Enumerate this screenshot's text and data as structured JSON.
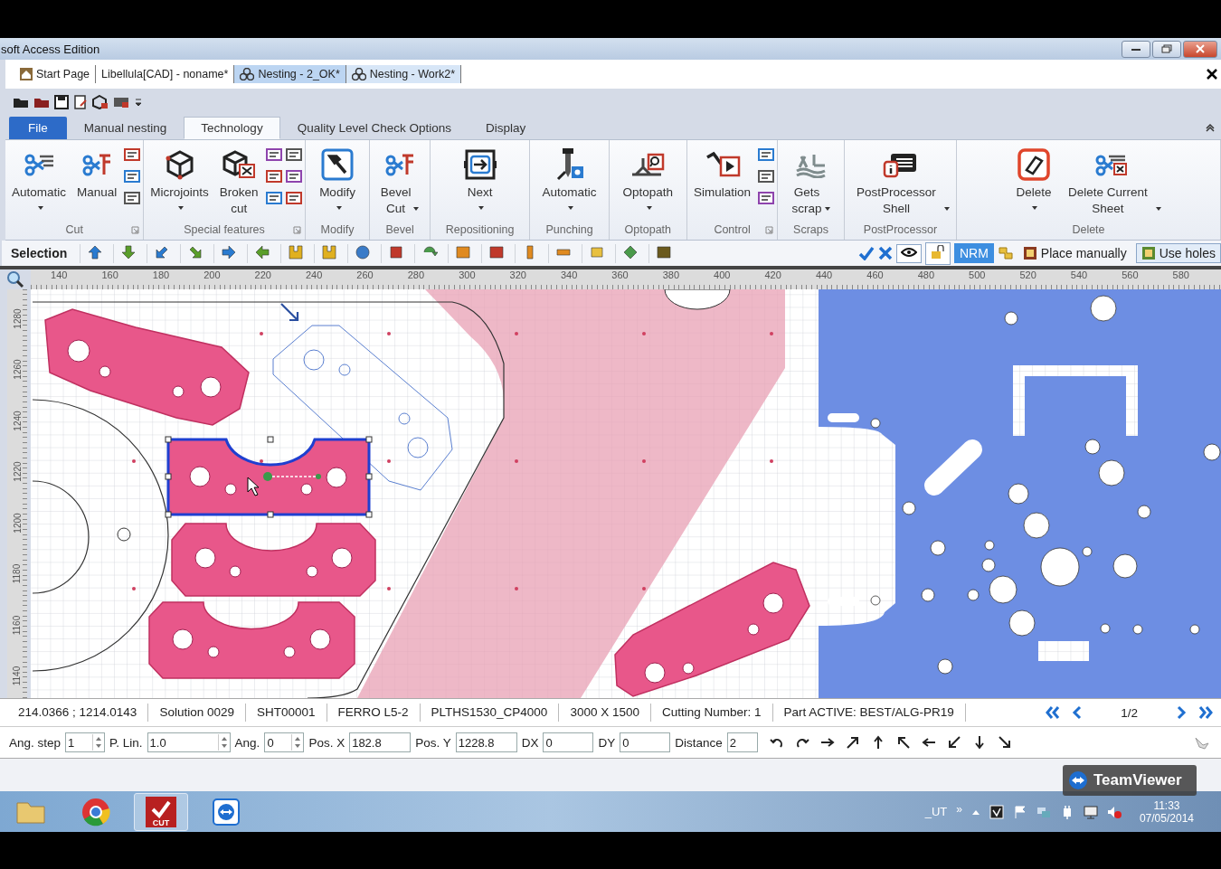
{
  "window": {
    "title": "soft Access Edition"
  },
  "doc_tabs": [
    {
      "label": "Start Page",
      "kind": "home",
      "selected": false
    },
    {
      "label": "Libellula[CAD] - noname*",
      "kind": "plain",
      "selected": false
    },
    {
      "label": "Nesting - 2_OK*",
      "kind": "nesting",
      "selected": true
    },
    {
      "label": "Nesting - Work2*",
      "kind": "nesting",
      "selected": false
    }
  ],
  "ribbon_tabs": [
    {
      "label": "File",
      "kind": "file",
      "selected": false
    },
    {
      "label": "Manual nesting",
      "kind": "tab",
      "selected": false
    },
    {
      "label": "Technology",
      "kind": "tab",
      "selected": true
    },
    {
      "label": "Quality Level Check Options",
      "kind": "tab",
      "selected": false
    },
    {
      "label": "Display",
      "kind": "tab",
      "selected": false
    }
  ],
  "ribbon_groups": [
    {
      "label": "Cut",
      "launcher": true,
      "items": [
        {
          "kind": "large",
          "label": "Automatic",
          "dropdown": true
        },
        {
          "kind": "large",
          "label": "Manual",
          "dropdown": false
        },
        {
          "kind": "small"
        }
      ]
    },
    {
      "label": "Special features",
      "launcher": true,
      "items": [
        {
          "kind": "large",
          "label": "Microjoints",
          "dropdown": true
        },
        {
          "kind": "large",
          "label": "Broken cut",
          "dropdown": false
        },
        {
          "kind": "small"
        },
        {
          "kind": "small"
        }
      ]
    },
    {
      "label": "Modify",
      "launcher": false,
      "items": [
        {
          "kind": "large",
          "label": "Modify",
          "dropdown": true
        }
      ]
    },
    {
      "label": "Bevel",
      "launcher": false,
      "items": [
        {
          "kind": "large",
          "label": "Bevel Cut",
          "dropdown": true
        }
      ]
    },
    {
      "label": "Repositioning",
      "launcher": false,
      "items": [
        {
          "kind": "large",
          "label": "Next",
          "dropdown": true
        }
      ]
    },
    {
      "label": "Punching",
      "launcher": false,
      "items": [
        {
          "kind": "large",
          "label": "Automatic",
          "dropdown": true
        }
      ]
    },
    {
      "label": "Optopath",
      "launcher": false,
      "items": [
        {
          "kind": "large",
          "label": "Optopath",
          "dropdown": true
        }
      ]
    },
    {
      "label": "Control",
      "launcher": true,
      "items": [
        {
          "kind": "large",
          "label": "Simulation",
          "dropdown": false
        },
        {
          "kind": "small"
        }
      ]
    },
    {
      "label": "Scraps",
      "launcher": false,
      "items": [
        {
          "kind": "large",
          "label": "Gets scrap",
          "dropdown": true
        }
      ]
    },
    {
      "label": "PostProcessor",
      "launcher": false,
      "items": [
        {
          "kind": "large",
          "label": "PostProcessor Shell",
          "dropdown": true
        }
      ]
    },
    {
      "label": "Delete",
      "launcher": false,
      "items": [
        {
          "kind": "large",
          "label": "Delete",
          "dropdown": true
        },
        {
          "kind": "large",
          "label": "Delete Current Sheet",
          "dropdown": true
        }
      ]
    }
  ],
  "selection_toolbar": {
    "label": "Selection",
    "right_tools": [
      {
        "kind": "text",
        "label": "NRM",
        "selected": true
      },
      {
        "kind": "labeled",
        "label": "Place manually",
        "selected": false
      },
      {
        "kind": "labeled",
        "label": "Use holes",
        "selected": true
      }
    ]
  },
  "ruler": {
    "horizontal": [
      "140",
      "160",
      "180",
      "200",
      "220",
      "240",
      "260",
      "280",
      "300",
      "320",
      "340",
      "360",
      "380",
      "400",
      "420",
      "440",
      "460",
      "480",
      "500",
      "520",
      "540",
      "560",
      "580"
    ],
    "vertical": [
      "1280",
      "1260",
      "1240",
      "1220",
      "1200",
      "1180",
      "1160",
      "1140"
    ]
  },
  "status_bar": {
    "cells": [
      "214.0366 ; 1214.0143",
      "Solution 0029",
      "SHT00001",
      "FERRO L5-2",
      "PLTHS1530_CP4000",
      "3000 X 1500",
      "Cutting Number: 1",
      "Part ACTIVE: BEST/ALG-PR19"
    ],
    "page": "1/2"
  },
  "input_bar": {
    "fields": [
      {
        "label": "Ang. step",
        "value": "1",
        "kind": "spin"
      },
      {
        "label": "P. Lin.",
        "value": "1.0",
        "kind": "spin"
      },
      {
        "label": "Ang.",
        "value": "0",
        "kind": "spin"
      },
      {
        "label": "Pos. X",
        "value": "182.8",
        "kind": "text"
      },
      {
        "label": "Pos. Y",
        "value": "1228.8",
        "kind": "text"
      },
      {
        "label": "DX",
        "value": "0",
        "kind": "text"
      },
      {
        "label": "DY",
        "value": "0",
        "kind": "text"
      },
      {
        "label": "Distance",
        "value": "2",
        "kind": "text"
      }
    ]
  },
  "teamviewer": {
    "label": "TeamViewer"
  },
  "taskbar": {
    "apps": [
      {
        "kind": "folder",
        "selected": false
      },
      {
        "kind": "browser",
        "selected": false
      },
      {
        "kind": "cut",
        "label": "CUT",
        "selected": true
      },
      {
        "kind": "remote",
        "selected": false
      }
    ],
    "overflow": "»",
    "tray_text": "_UT",
    "time": "11:33",
    "date": "07/05/2014"
  }
}
